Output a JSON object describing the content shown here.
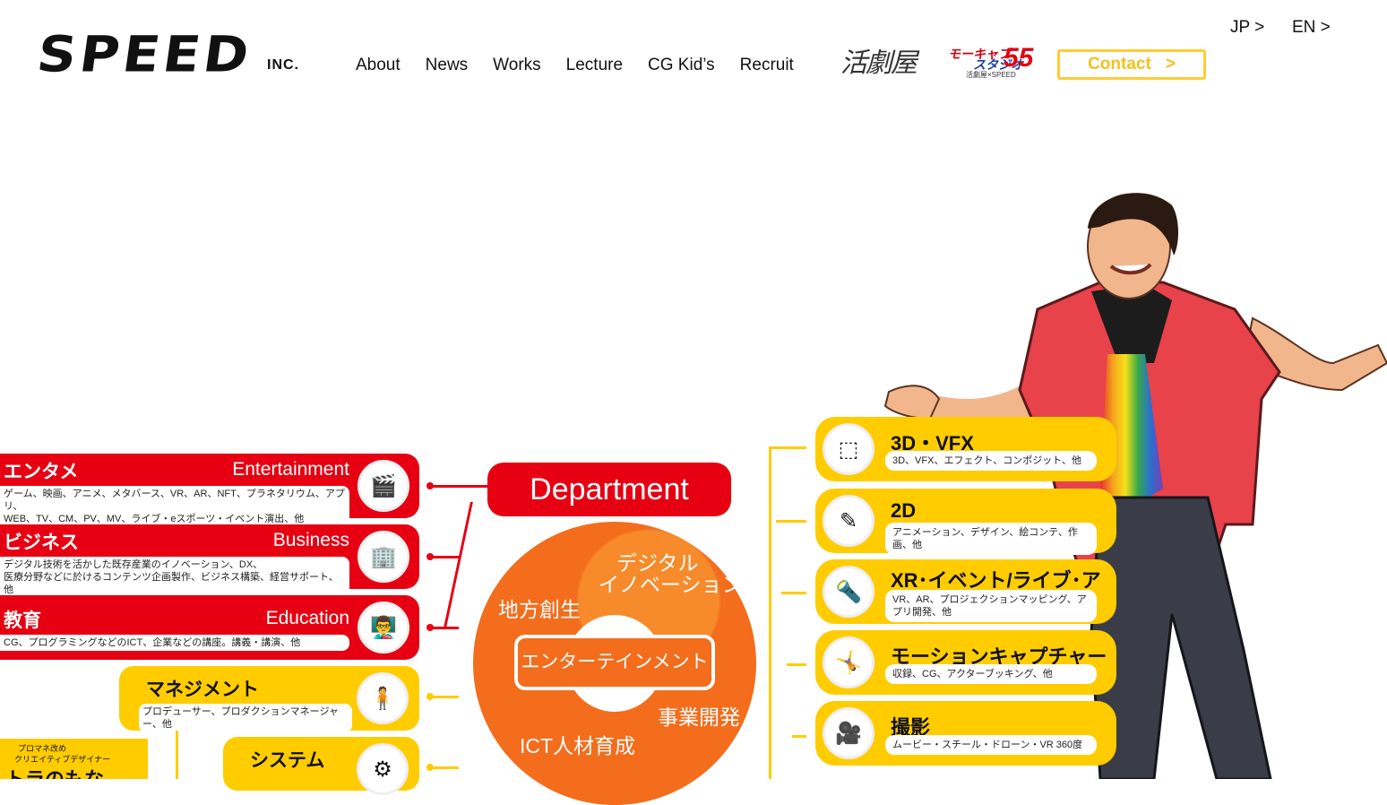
{
  "header": {
    "logo_text": "SPEED",
    "logo_suffix": "INC.",
    "nav": [
      "About",
      "News",
      "Works",
      "Lecture",
      "CG Kid’s",
      "Recruit"
    ],
    "partner1": "活劇屋",
    "partner2": {
      "line1": "モーキャプ",
      "line2": "スタジオ",
      "num": "55",
      "small": "活劇屋×SPEED"
    },
    "contact": "Contact",
    "contact_arrow": ">",
    "lang_jp": "JP >",
    "lang_en": "EN >"
  },
  "left_items": [
    {
      "jp": "エンタメ",
      "en": "Entertainment",
      "desc1": "ゲーム、映画、アニメ、メタバース、VR、AR、NFT、プラネタリウム、アプリ、",
      "desc2": "WEB、TV、CM、PV、MV、ライブ・eスポーツ・イベント演出、他",
      "icon": "film-reel-icon",
      "glyph": "🎬"
    },
    {
      "jp": "ビジネス",
      "en": "Business",
      "desc1": "デジタル技術を活かした既存産業のイノベーション、DX、",
      "desc2": "医療分野などに於けるコンテンツ企画製作、ビジネス構築、経営サポート、他",
      "icon": "building-icon",
      "glyph": "🏢"
    },
    {
      "jp": "教育",
      "en": "Education",
      "desc1": "CG、プログラミングなどのICT、企業などの講座。講義・講演、他",
      "desc2": "",
      "icon": "lecture-icon",
      "glyph": "👨‍🏫"
    }
  ],
  "management": {
    "title": "マネジメント",
    "desc": "プロデューサー、プロダクションマネージャー、他",
    "icon": "person-icon",
    "glyph": "🧍"
  },
  "system": {
    "title": "システム",
    "icon": "monitor-icon",
    "glyph": "⚙"
  },
  "department": "Department",
  "ring": {
    "center": "エンターテインメント",
    "labels": [
      "デジタル",
      "イノベーション",
      "地方創生",
      "事業開発",
      "ICT人材育成"
    ]
  },
  "right_items": [
    {
      "title": "3D・VFX",
      "desc": "3D、VFX、エフェクト、コンポジット、他",
      "icon": "cube-icon",
      "glyph": "⬚"
    },
    {
      "title": "2D",
      "desc": "アニメーション、デザイン、絵コンテ、作画、他",
      "icon": "pen-icon",
      "glyph": "✎"
    },
    {
      "title": "XR･イベント/ライブ･アプリ開発",
      "desc": "VR、AR、プロジェクションマッピング、アプリ開発、他",
      "icon": "stage-light-icon",
      "glyph": "🔦"
    },
    {
      "title": "モーションキャプチャー",
      "desc": "収録、CG、アクターブッキング、他",
      "icon": "motion-capture-icon",
      "glyph": "🤸"
    },
    {
      "title": "撮影",
      "desc": "ムービー・スチール・ドローン・VR 360度",
      "icon": "camera-icon",
      "glyph": "🎥"
    }
  ],
  "ad": {
    "line1": "プロマネ改め",
    "line2": "クリエイティブデザイナー",
    "line3": "トラのもな"
  },
  "colors": {
    "red": "#e60012",
    "yellow": "#ffcc00",
    "orange": "#f36d1c",
    "contact": "#f6c01c"
  }
}
